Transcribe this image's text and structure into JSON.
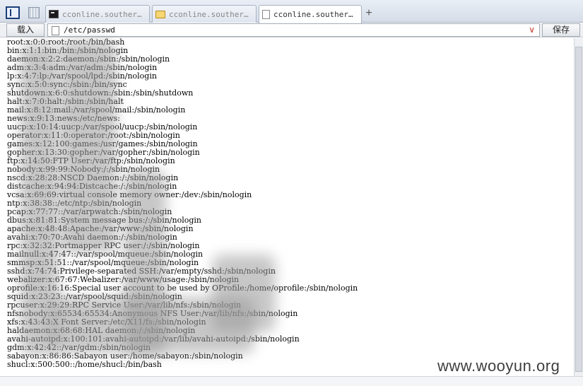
{
  "tabs": [
    {
      "title": "cconline.southern...",
      "icon": "terminal-icon",
      "active": false
    },
    {
      "title": "cconline.southern...",
      "icon": "folder-icon",
      "active": false
    },
    {
      "title": "cconline.southern...",
      "icon": "file-icon",
      "active": true
    }
  ],
  "toolbar": {
    "load_label": "载入",
    "save_label": "保存",
    "path_value": "/etc/passwd"
  },
  "file_lines": [
    "root:x:0:0:root:/root:/bin/bash",
    "bin:x:1:1:bin:/bin:/sbin/nologin",
    "daemon:x:2:2:daemon:/sbin:/sbin/nologin",
    "adm:x:3:4:adm:/var/adm:/sbin/nologin",
    "lp:x:4:7:lp:/var/spool/lpd:/sbin/nologin",
    "sync:x:5:0:sync:/sbin:/bin/sync",
    "shutdown:x:6:0:shutdown:/sbin:/sbin/shutdown",
    "halt:x:7:0:halt:/sbin:/sbin/halt",
    "mail:x:8:12:mail:/var/spool/mail:/sbin/nologin",
    "news:x:9:13:news:/etc/news:",
    "uucp:x:10:14:uucp:/var/spool/uucp:/sbin/nologin",
    "operator:x:11:0:operator:/root:/sbin/nologin",
    "games:x:12:100:games:/usr/games:/sbin/nologin",
    "gopher:x:13:30:gopher:/var/gopher:/sbin/nologin",
    "ftp:x:14:50:FTP User:/var/ftp:/sbin/nologin",
    "nobody:x:99:99:Nobody:/:/sbin/nologin",
    "nscd:x:28:28:NSCD Daemon:/:/sbin/nologin",
    "distcache:x:94:94:Distcache:/:/sbin/nologin",
    "vcsa:x:69:69:virtual console memory owner:/dev:/sbin/nologin",
    "ntp:x:38:38::/etc/ntp:/sbin/nologin",
    "pcap:x:77:77::/var/arpwatch:/sbin/nologin",
    "dbus:x:81:81:System message bus:/:/sbin/nologin",
    "apache:x:48:48:Apache:/var/www:/sbin/nologin",
    "avahi:x:70:70:Avahi daemon:/:/sbin/nologin",
    "rpc:x:32:32:Portmapper RPC user:/:/sbin/nologin",
    "mailnull:x:47:47::/var/spool/mqueue:/sbin/nologin",
    "smmsp:x:51:51::/var/spool/mqueue:/sbin/nologin",
    "sshd:x:74:74:Privilege-separated SSH:/var/empty/sshd:/sbin/nologin",
    "webalizer:x:67:67:Webalizer:/var/www/usage:/sbin/nologin",
    "oprofile:x:16:16:Special user account to be used by OProfile:/home/oprofile:/sbin/nologin",
    "squid:x:23:23::/var/spool/squid:/sbin/nologin",
    "rpcuser:x:29:29:RPC Service User:/var/lib/nfs:/sbin/nologin",
    "nfsnobody:x:65534:65534:Anonymous NFS User:/var/lib/nfs:/sbin/nologin",
    "xfs:x:43:43:X Font Server:/etc/X11/fs:/sbin/nologin",
    "haldaemon:x:68:68:HAL daemon:/:/sbin/nologin",
    "avahi-autoipd:x:100:101:avahi-autoipd:/var/lib/avahi-autoipd:/sbin/nologin",
    "gdm:x:42:42::/var/gdm:/sbin/nologin",
    "sabayon:x:86:86:Sabayon user:/home/sabayon:/sbin/nologin",
    "shucl:x:500:500::/home/shucl:/bin/bash"
  ],
  "watermark": "www.wooyun.org"
}
